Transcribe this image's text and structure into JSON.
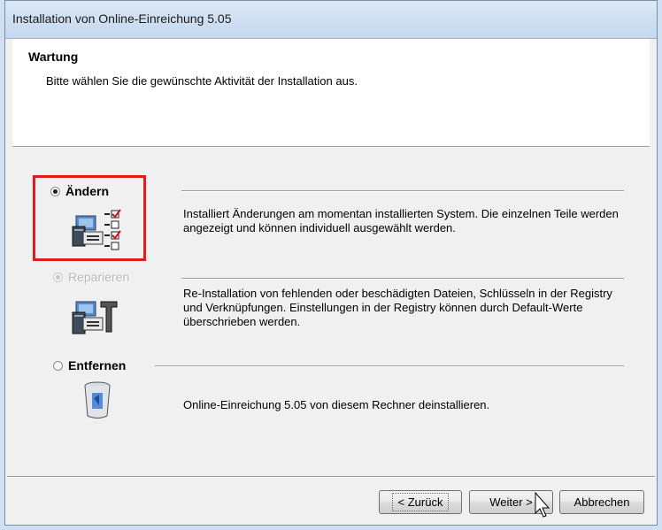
{
  "window": {
    "title": "Installation von Online-Einreichung 5.05"
  },
  "header": {
    "title": "Wartung",
    "subtitle": "Bitte wählen Sie die gewünschte Aktivität der Installation aus."
  },
  "options": [
    {
      "label": "Ändern",
      "selected": true,
      "enabled": true,
      "icon": "modify-icon",
      "description": "Installiert Änderungen am momentan installierten System. Die einzelnen Teile werden angezeigt und können individuell ausgewählt werden."
    },
    {
      "label": "Reparieren",
      "selected": false,
      "enabled": false,
      "icon": "repair-icon",
      "description": "Re-Installation von fehlenden oder beschädigten Dateien, Schlüsseln in der Registry und Verknüpfungen. Einstellungen in der Registry können durch Default-Werte überschrieben werden."
    },
    {
      "label": "Entfernen",
      "selected": false,
      "enabled": true,
      "icon": "recycle-bin-icon",
      "description": "Online-Einreichung 5.05 von diesem Rechner deinstallieren."
    }
  ],
  "buttons": {
    "back": "< Zurück",
    "next": "Weiter >",
    "cancel": "Abbrechen"
  },
  "colors": {
    "highlight": "#e21b1b",
    "titlebar": "#c5d8ee"
  }
}
